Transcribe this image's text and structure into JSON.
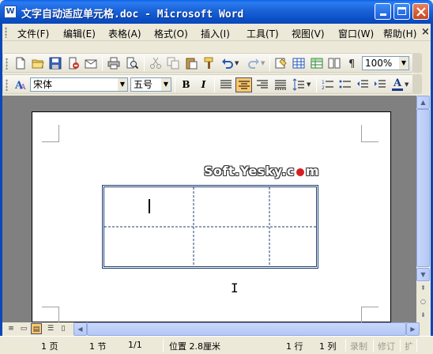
{
  "window": {
    "title": "文字自动适应单元格.doc - Microsoft Word",
    "app_icon": "W"
  },
  "menu": {
    "items": [
      "文件(F)",
      "编辑(E)",
      "表格(A)",
      "格式(O)",
      "插入(I)",
      "工具(T)",
      "视图(V)",
      "窗口(W)",
      "帮助(H)"
    ],
    "close_glyph": "×"
  },
  "toolbar_standard": {
    "zoom": "100%"
  },
  "toolbar_format": {
    "font_name": "宋体",
    "font_size": "五号",
    "bold": "B",
    "italic": "I",
    "align_center_active": true,
    "font_color_label": "A"
  },
  "document": {
    "watermark_left": "Soft.Yesky.c",
    "watermark_right": "m",
    "watermark_dot": "图"
  },
  "statusbar": {
    "page": "1 页",
    "section": "1 节",
    "page_of": "1/1",
    "position": "位置 2.8厘米",
    "line": "1 行",
    "column": "1 列",
    "rec": "录制",
    "trk": "修订",
    "ext": "扩"
  },
  "colors": {
    "title_bar": "#0A5FE8",
    "table_border": "#1F3F6F",
    "active_button": "#FFC96B"
  }
}
